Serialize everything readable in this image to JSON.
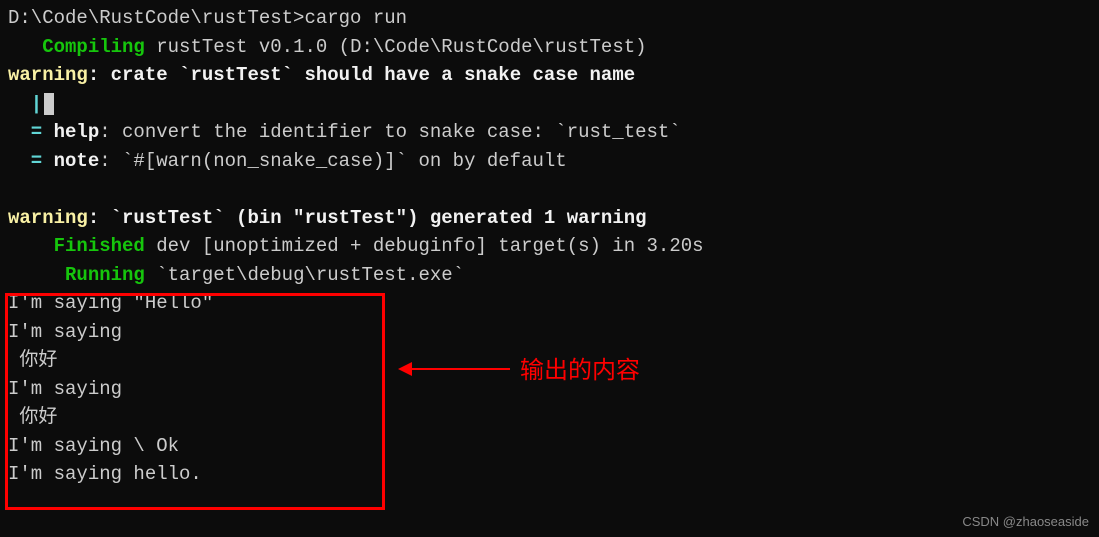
{
  "terminal": {
    "prompt_line": "D:\\Code\\RustCode\\rustTest>cargo run",
    "compiling_label": "Compiling",
    "compiling_text": " rustTest v0.1.0 (D:\\Code\\RustCode\\rustTest)",
    "warning1_label": "warning",
    "warning1_text": ": crate `rustTest` should have a snake case name",
    "pipe_line": "  |",
    "help_prefix": "  = ",
    "help_label": "help",
    "help_text": ": convert the identifier to snake case: `rust_test`",
    "note_prefix": "  = ",
    "note_label": "note",
    "note_text": ": `#[warn(non_snake_case)]` on by default",
    "warning2_label": "warning",
    "warning2_text": ": `rustTest` (bin \"rustTest\") generated 1 warning",
    "finished_label": "Finished",
    "finished_text": " dev [unoptimized + debuginfo] target(s) in 3.20s",
    "running_label": "Running",
    "running_text": " `target\\debug\\rustTest.exe`",
    "output": {
      "line1": "I'm saying \"Hello\"",
      "line2": "I'm saying",
      "line3": " 你好",
      "line4": "I'm saying",
      "line5": " 你好",
      "line6": "I'm saying \\ Ok",
      "line7": "I'm saying hello."
    }
  },
  "annotation_text": "输出的内容",
  "watermark_text": "CSDN @zhaoseaside"
}
